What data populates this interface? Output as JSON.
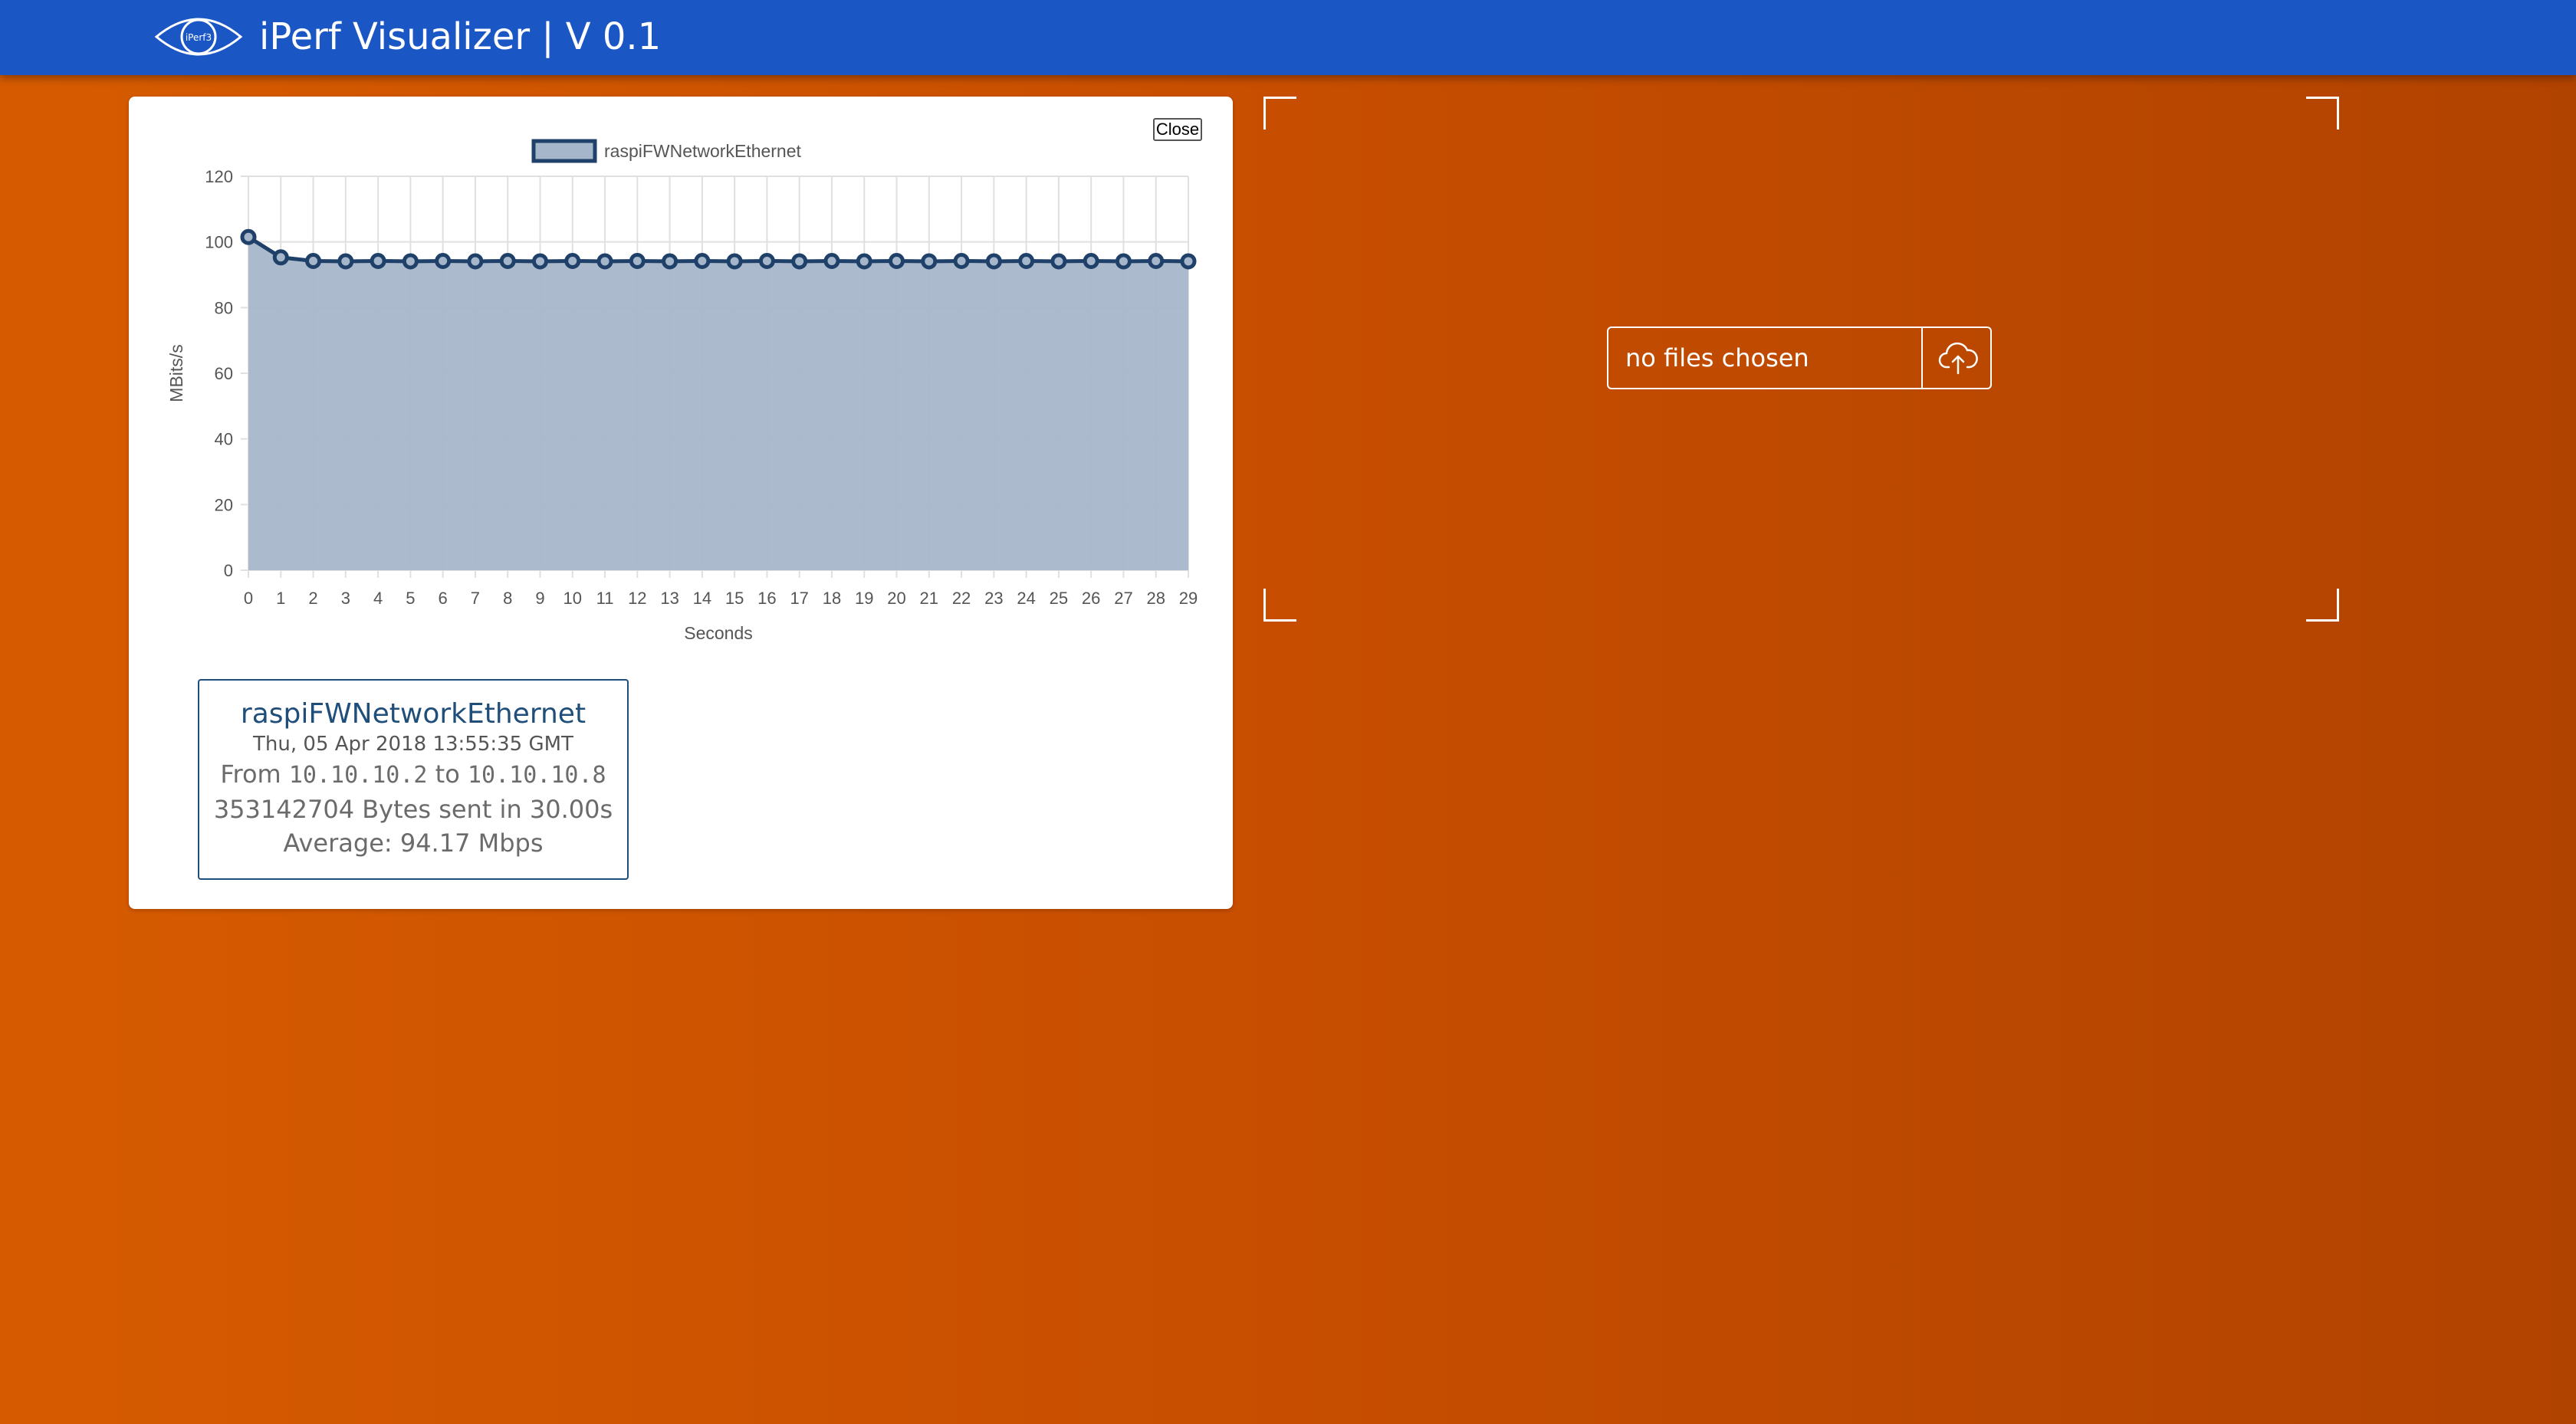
{
  "header": {
    "logo_text": "iPerf3",
    "title": "iPerf Visualizer | V 0.1"
  },
  "chart_card": {
    "close_label": "Close"
  },
  "chart_data": {
    "type": "area",
    "title": "",
    "xlabel": "Seconds",
    "ylabel": "MBits/s",
    "ylim": [
      0,
      120
    ],
    "yticks": [
      0,
      20,
      40,
      60,
      80,
      100,
      120
    ],
    "grid": true,
    "legend_position": "top",
    "colors": {
      "line": "#1f4068",
      "fill": "#a6b6ca",
      "grid": "#e0e0e0",
      "axis_text": "#555555"
    },
    "x": [
      0,
      1,
      2,
      3,
      4,
      5,
      6,
      7,
      8,
      9,
      10,
      11,
      12,
      13,
      14,
      15,
      16,
      17,
      18,
      19,
      20,
      21,
      22,
      23,
      24,
      25,
      26,
      27,
      28,
      29
    ],
    "series": [
      {
        "name": "raspiFWNetworkEthernet",
        "values": [
          101.5,
          95.3,
          94.2,
          94.1,
          94.2,
          94.1,
          94.2,
          94.1,
          94.2,
          94.1,
          94.2,
          94.1,
          94.2,
          94.1,
          94.2,
          94.1,
          94.2,
          94.1,
          94.2,
          94.1,
          94.2,
          94.1,
          94.2,
          94.1,
          94.2,
          94.1,
          94.2,
          94.1,
          94.2,
          94.1
        ]
      }
    ]
  },
  "summary": {
    "name": "raspiFWNetworkEthernet",
    "date": "Thu, 05 Apr 2018 13:55:35 GMT",
    "from_label": "From",
    "from_ip": "10.10.10.2",
    "to_label": "to",
    "to_ip": "10.10.10.8",
    "bytes_line": "353142704 Bytes sent in 30.00s",
    "average_line": "Average: 94.17 Mbps"
  },
  "upload": {
    "file_status": "no files chosen",
    "icon": "cloud-upload-icon"
  }
}
